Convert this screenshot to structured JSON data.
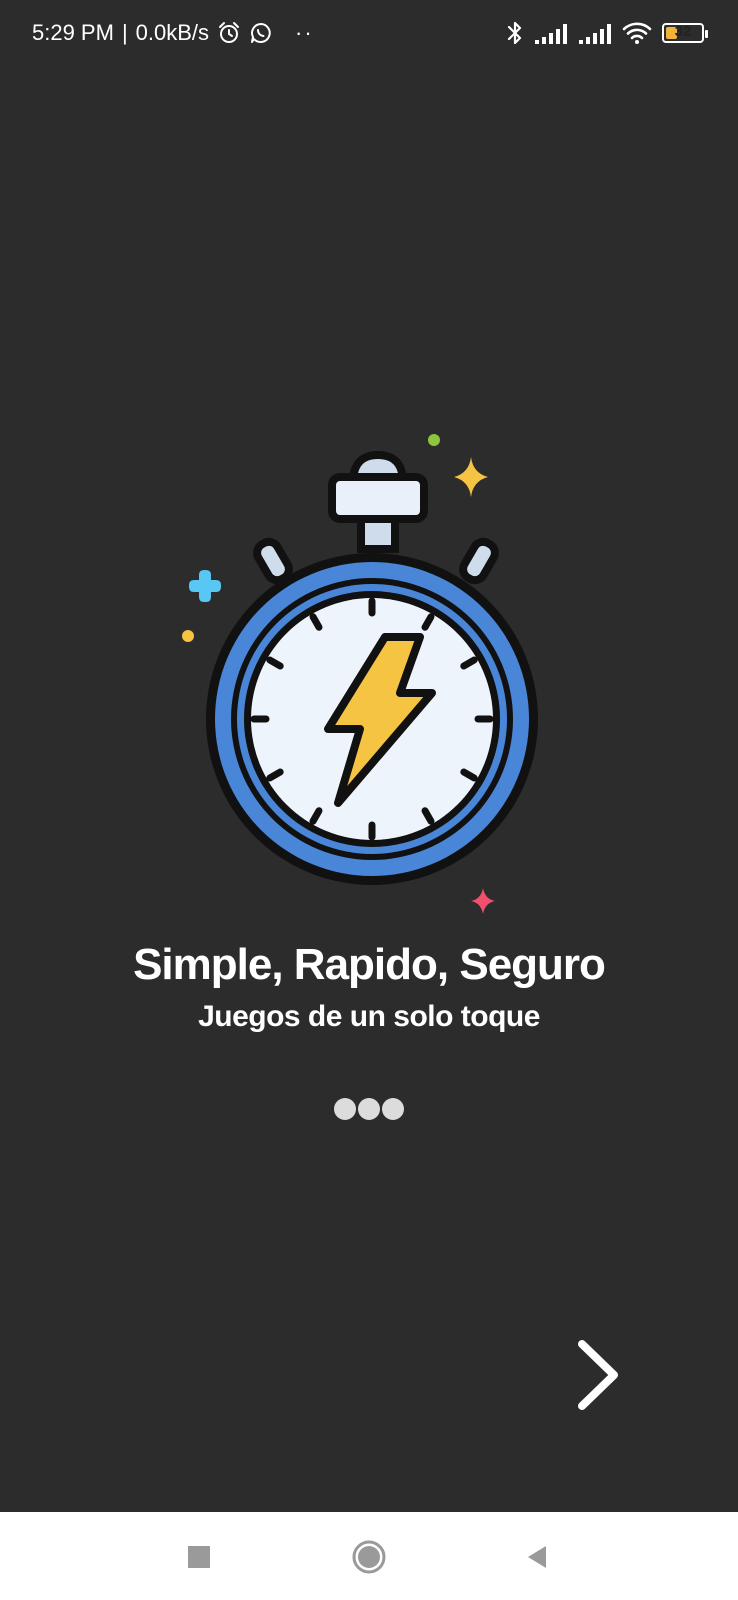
{
  "status_bar": {
    "time": "5:29 PM",
    "separator": "|",
    "network_speed": "0.0kB/s",
    "more_indicator": "··",
    "battery_level": "32",
    "battery_fraction": 0.32,
    "icons_left": [
      "alarm-icon",
      "whatsapp-icon"
    ],
    "icons_right": [
      "bluetooth-icon",
      "signal-icon",
      "signal-icon",
      "wifi-icon",
      "battery-icon"
    ]
  },
  "onboarding": {
    "illustration": "stopwatch-lightning-icon",
    "title": "Simple, Rapido, Seguro",
    "subtitle": "Juegos de un solo toque",
    "page_count": 3,
    "next_icon": "chevron-right-icon"
  },
  "nav_bar": {
    "buttons": [
      "recents-square-icon",
      "home-circle-icon",
      "back-triangle-icon"
    ]
  },
  "colors": {
    "background": "#2c2c2c",
    "text": "#ffffff",
    "watch_ring": "#4a86d8",
    "watch_face": "#eef4fc",
    "bolt": "#f5c443",
    "sparkle_yellow": "#f5c443",
    "sparkle_blue": "#58c7f3",
    "sparkle_red": "#f0506e",
    "sparkle_green": "#8cc63f",
    "nav_bar": "#ffffff",
    "pager_dot": "#dcdcdc"
  }
}
